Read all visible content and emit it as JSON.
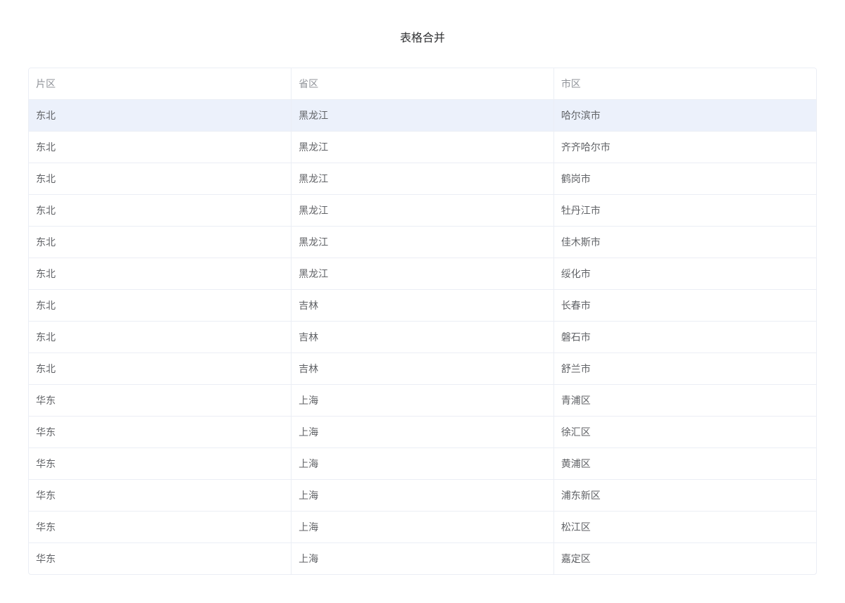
{
  "title": "表格合并",
  "headers": {
    "region": "片区",
    "province": "省区",
    "city": "市区"
  },
  "rows": [
    {
      "region": "东北",
      "province": "黑龙江",
      "city": "哈尔滨市",
      "highlight": true
    },
    {
      "region": "东北",
      "province": "黑龙江",
      "city": "齐齐哈尔市"
    },
    {
      "region": "东北",
      "province": "黑龙江",
      "city": "鹤岗市"
    },
    {
      "region": "东北",
      "province": "黑龙江",
      "city": "牡丹江市"
    },
    {
      "region": "东北",
      "province": "黑龙江",
      "city": "佳木斯市"
    },
    {
      "region": "东北",
      "province": "黑龙江",
      "city": "绥化市"
    },
    {
      "region": "东北",
      "province": "吉林",
      "city": "长春市"
    },
    {
      "region": "东北",
      "province": "吉林",
      "city": "磐石市"
    },
    {
      "region": "东北",
      "province": "吉林",
      "city": "舒兰市"
    },
    {
      "region": "华东",
      "province": "上海",
      "city": "青浦区"
    },
    {
      "region": "华东",
      "province": "上海",
      "city": "徐汇区"
    },
    {
      "region": "华东",
      "province": "上海",
      "city": "黄浦区"
    },
    {
      "region": "华东",
      "province": "上海",
      "city": "浦东新区"
    },
    {
      "region": "华东",
      "province": "上海",
      "city": "松江区"
    },
    {
      "region": "华东",
      "province": "上海",
      "city": "嘉定区"
    }
  ]
}
